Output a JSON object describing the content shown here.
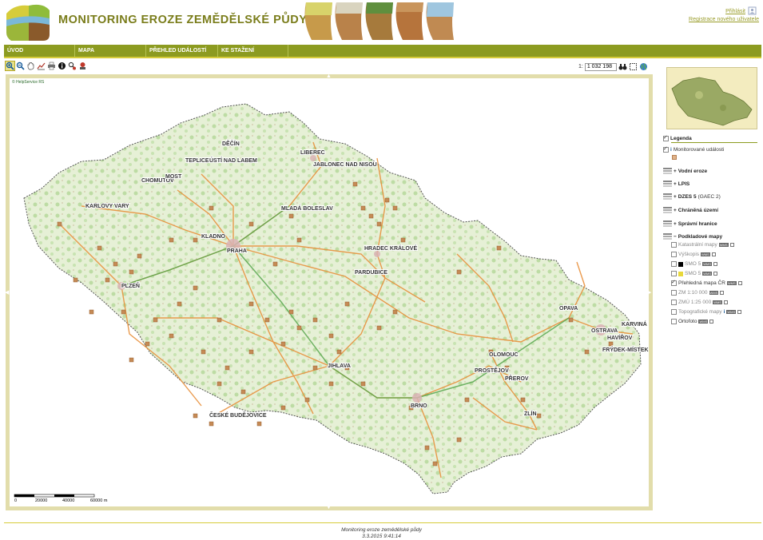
{
  "header": {
    "title": "MONITORING EROZE ZEMĚDĚLSKÉ PŮDY",
    "login": "Přihlásit",
    "register": "Registrace nového uživatele"
  },
  "nav": {
    "items": [
      "ÚVOD",
      "MAPA",
      "PŘEHLED UDÁLOSTÍ",
      "KE STAŽENÍ"
    ]
  },
  "toolbar": {
    "tools": [
      "zoom-in-icon",
      "zoom-out-icon",
      "pan-hand-icon",
      "measure-icon",
      "print-icon",
      "info-icon",
      "search-parcel-icon",
      "event-icon"
    ],
    "scale_prefix": "1:",
    "scale_value": "1 032 198",
    "extra": [
      "binoculars-icon",
      "select-box-icon",
      "globe-icon"
    ]
  },
  "map": {
    "attribution": "© HelpService RS",
    "scale_labels": [
      "0",
      "20000",
      "40000",
      "60000 m"
    ],
    "cities": [
      "DĚČÍN",
      "LIBEREC",
      "TEPLICE",
      "ÚSTÍ NAD LABEM",
      "JABLONEC NAD NISOU",
      "CHOMUTOV",
      "MOST",
      "KARLOVY VARY",
      "MLADÁ BOLESLAV",
      "KLADNO",
      "PRAHA",
      "HRADEC KRÁLOVÉ",
      "PARDUBICE",
      "PLZEŇ",
      "OPAVA",
      "KARVINÁ",
      "OSTRAVA",
      "HAVÍŘOV",
      "FRÝDEK-MÍSTEK",
      "OLOMOUC",
      "PROSTĚJOV",
      "PŘEROV",
      "JIHLAVA",
      "BRNO",
      "ZLÍN",
      "ČESKÉ BUDĚJOVICE"
    ]
  },
  "legend": {
    "title": "Legenda",
    "monitored": "Monitorované události",
    "groups": {
      "water": "Vodní eroze",
      "lpis": "LPIS",
      "dzes": "DZES 5",
      "dzes_sub": "(GAEC 2)",
      "protected": "Chráněná území",
      "admin": "Správní hranice",
      "base": "Podkladové mapy"
    },
    "base_items": [
      "Katastrální mapy",
      "Výškopis",
      "SMO 5",
      "SMO 5",
      "Přehledná mapa ČR",
      "ZM 1:10 000",
      "ZMÚ 1:25 000",
      "Topografické mapy",
      "Ortofoto"
    ],
    "wms_tag": "WMS"
  },
  "footer": {
    "line1": "Monitoring eroze zemědělské půdy",
    "line2": "3.3.2015 9:41:14"
  },
  "colors": {
    "accent": "#8c9b20",
    "title": "#7a7d1b",
    "event": "#c58a55",
    "roads": "#e8913c",
    "highway": "#5aa850",
    "land": "#e4efd0",
    "forest": "#b9dca0"
  }
}
